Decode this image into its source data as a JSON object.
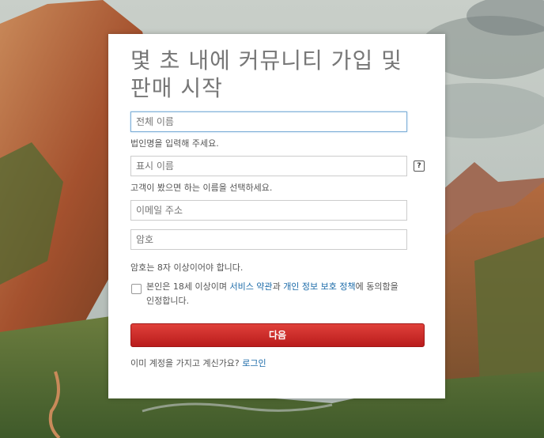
{
  "form": {
    "title": "몇 초 내에 커뮤니티 가입 및 판매 시작",
    "full_name_placeholder": "전체 이름",
    "full_name_hint": "법인명을 입력해 주세요.",
    "display_name_placeholder": "표시 이름",
    "display_name_hint": "고객이 봤으면 하는 이름을 선택하세요.",
    "help_icon_label": "?",
    "email_placeholder": "이메일 주소",
    "password_placeholder": "암호",
    "password_hint": "암호는 8자 이상이어야 합니다.",
    "consent_prefix": "본인은 18세 이상이며 ",
    "terms_link": "서비스 약관",
    "consent_and": "과 ",
    "privacy_link": "개인 정보 보호 정책",
    "consent_suffix": "에 동의함을 인정합니다.",
    "next_button": "다음",
    "login_prompt": "이미 계정을 가지고 계신가요? ",
    "login_link": "로그인"
  },
  "colors": {
    "button": "#d32f2f",
    "link": "#1a6aa8"
  }
}
